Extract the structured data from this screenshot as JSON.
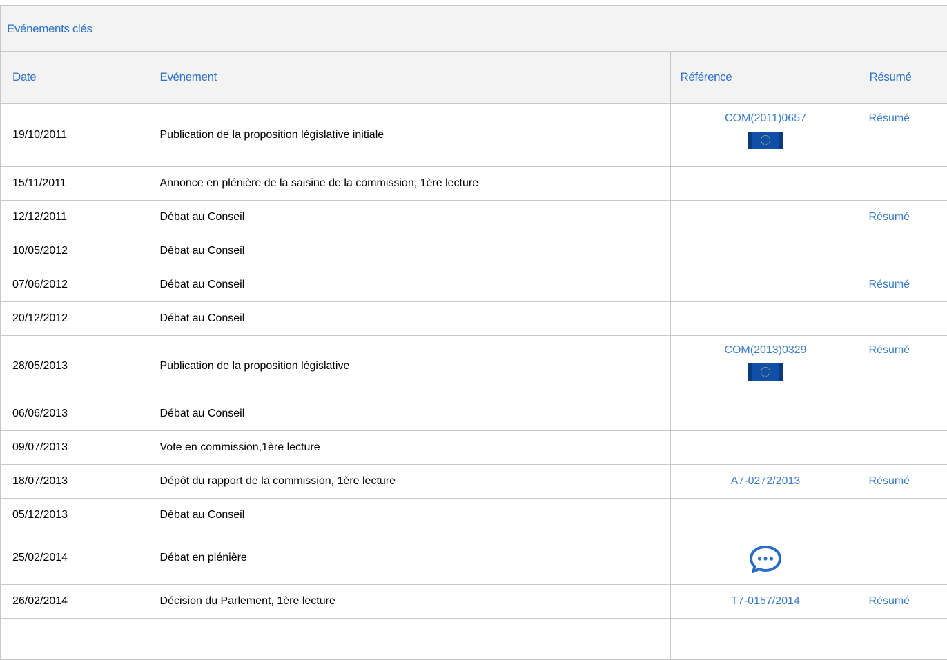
{
  "panel": {
    "title": "Evénements clés"
  },
  "columns": {
    "date": "Date",
    "event": "Evénement",
    "reference": "Référence",
    "summary": "Résumé"
  },
  "rows": [
    {
      "date": "19/10/2011",
      "event": "Publication de la proposition législative initiale",
      "reference": "COM(2011)0657",
      "ref_icon": "eu-flag-icon",
      "summary": "Résumé"
    },
    {
      "date": "15/11/2011",
      "event": "Annonce en plénière de la saisine de la commission, 1ère lecture",
      "reference": "",
      "summary": ""
    },
    {
      "date": "12/12/2011",
      "event": "Débat au Conseil",
      "reference": "",
      "summary": "Résumé"
    },
    {
      "date": "10/05/2012",
      "event": "Débat au Conseil",
      "reference": "",
      "summary": ""
    },
    {
      "date": "07/06/2012",
      "event": "Débat au Conseil",
      "reference": "",
      "summary": "Résumé"
    },
    {
      "date": "20/12/2012",
      "event": "Débat au Conseil",
      "reference": "",
      "summary": ""
    },
    {
      "date": "28/05/2013",
      "event": "Publication de la proposition législative",
      "reference": "COM(2013)0329",
      "ref_icon": "eu-flag-icon",
      "summary": "Résumé"
    },
    {
      "date": "06/06/2013",
      "event": "Débat au Conseil",
      "reference": "",
      "summary": ""
    },
    {
      "date": "09/07/2013",
      "event": "Vote en commission,1ère lecture",
      "reference": "",
      "summary": ""
    },
    {
      "date": "18/07/2013",
      "event": "Dépôt du rapport de la commission, 1ère lecture",
      "reference": "A7-0272/2013",
      "summary": "Résumé"
    },
    {
      "date": "05/12/2013",
      "event": "Débat au Conseil",
      "reference": "",
      "summary": ""
    },
    {
      "date": "25/02/2014",
      "event": "Débat en plénière",
      "reference": "",
      "ref_icon": "chat-bubble-icon",
      "summary": ""
    },
    {
      "date": "26/02/2014",
      "event": "Décision du Parlement, 1ère lecture",
      "reference": "T7-0157/2014",
      "summary": "Résumé"
    },
    {
      "date": "",
      "event": "",
      "reference": "",
      "summary": ""
    }
  ],
  "colors": {
    "link": "#3b7fc8",
    "header_text": "#2c72c7",
    "header_bg": "#f3f3f3",
    "border": "#c8c8c8",
    "flag_blue": "#0f4fa8",
    "chat_icon": "#2b6cc4"
  }
}
